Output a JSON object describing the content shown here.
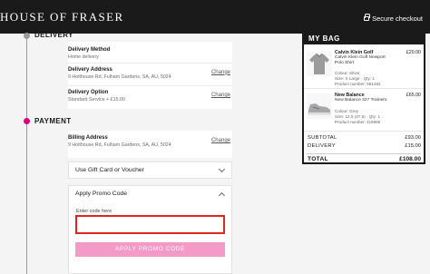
{
  "header": {
    "logo": "HOUSE OF FRASER",
    "secure_checkout": "Secure checkout"
  },
  "steps": {
    "delivery_title": "DELIVERY",
    "payment_title": "PAYMENT"
  },
  "delivery": {
    "method_label": "Delivery Method",
    "method_value": "Home delivery",
    "address_label": "Delivery Address",
    "address_value": "9 Holthouse Rd, Fulham Gardens, SA, AU, 5024",
    "option_label": "Delivery Option",
    "option_value": "Standard Service + £15.00",
    "change_label": "Change"
  },
  "payment": {
    "billing_label": "Billing Address",
    "billing_value": "9 Holthouse Rd, Fulham Gardens, SA, AU, 5024",
    "change_label": "Change",
    "gift_card_label": "Use Gift Card or Voucher",
    "promo_label": "Apply Promo Code",
    "promo_input_label": "Enter code here",
    "promo_input_value": "",
    "apply_button": "APPLY PROMO CODE"
  },
  "bag": {
    "title": "MY BAG",
    "items": [
      {
        "brand": "Calvin Klein Golf",
        "description": "Calvin Klein Golf Newport Polo Shirt",
        "price": "£20.00",
        "colour": "Colour: Silver",
        "size_qty": "Size: X Large · Qty: 1",
        "product_number": "Product number: 561482",
        "thumb_icon": "polo-shirt-icon"
      },
      {
        "brand": "New Balance",
        "description": "New Balance 327 Trainers",
        "price": "£65.00",
        "colour": "Colour: Grey",
        "size_qty": "Size: 12.5 (47.5) · Qty: 1",
        "product_number": "Product number: 116986",
        "thumb_icon": "trainer-shoe-icon"
      }
    ],
    "subtotal_label": "SUBTOTAL",
    "subtotal_value": "£93.00",
    "delivery_label": "DELIVERY",
    "delivery_value": "£15.00",
    "total_label": "TOTAL",
    "total_value": "£108.00"
  },
  "colors": {
    "header_bg": "#1a1a1a",
    "accent_pink": "#d6007e",
    "button_pink": "#f39ac8",
    "error_red": "#e0241f"
  }
}
